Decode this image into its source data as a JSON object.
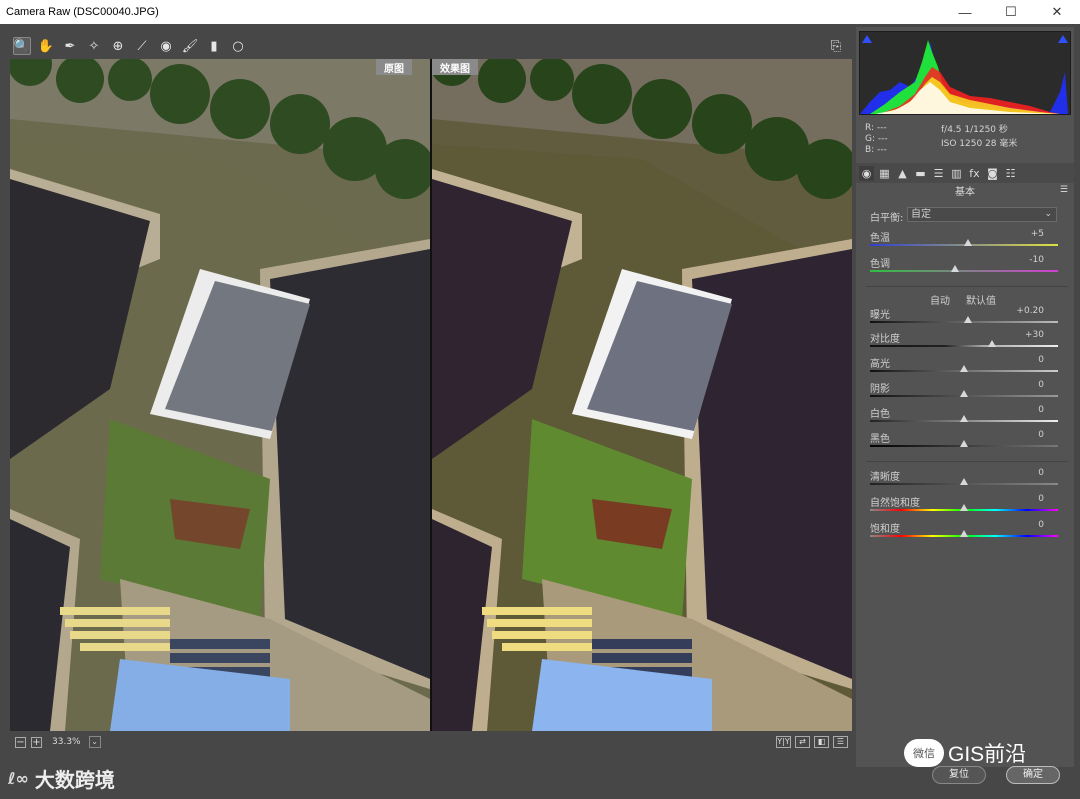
{
  "window": {
    "title": "Camera Raw (DSC00040.JPG)",
    "minimize": "—",
    "maximize": "☐",
    "close": "✕"
  },
  "toolbar": {
    "tools": [
      {
        "name": "zoom-tool-icon",
        "glyph": "🔍"
      },
      {
        "name": "hand-tool-icon",
        "glyph": "✋"
      },
      {
        "name": "white-balance-tool-icon",
        "glyph": "✒"
      },
      {
        "name": "color-sampler-tool-icon",
        "glyph": "✧"
      },
      {
        "name": "targeted-adjustment-tool-icon",
        "glyph": "⊕"
      },
      {
        "name": "straighten-tool-icon",
        "glyph": "⟋"
      },
      {
        "name": "red-eye-tool-icon",
        "glyph": "◉"
      },
      {
        "name": "adjustment-brush-icon",
        "glyph": "🖌"
      },
      {
        "name": "graduated-filter-icon",
        "glyph": "▮"
      },
      {
        "name": "radial-filter-icon",
        "glyph": "○"
      }
    ],
    "export_glyph": "⎘"
  },
  "preview": {
    "before_label": "原图",
    "after_label": "效果图"
  },
  "bottom_bar": {
    "zoom_out": "−",
    "zoom_in": "+",
    "zoom_value": "33.3%",
    "zoom_dropdown": "⌄",
    "view_buttons": [
      "Y|Y",
      "⇄",
      "◧",
      "☰"
    ]
  },
  "histogram": {
    "colors": {
      "red": "#ff2020",
      "green": "#20ff20",
      "blue": "#2030ff",
      "yellow": "#ffff20",
      "white": "#ffffff"
    }
  },
  "metadata": {
    "r": "R: ---",
    "g": "G: ---",
    "b": "B: ---",
    "exif_line1": "f/4.5  1/1250 秒",
    "exif_line2": "ISO 1250  28 毫米"
  },
  "panel_tabs": [
    "◉",
    "▦",
    "▲",
    "▬",
    "☰",
    "▥",
    "fx",
    "◙",
    "☷"
  ],
  "basic": {
    "section_title": "基本",
    "section_menu": "☰",
    "white_balance_label": "白平衡:",
    "white_balance_value": "自定",
    "white_balance_dropdown": "⌄",
    "auto": "自动",
    "defaults": "默认值",
    "sliders": [
      {
        "label": "色温",
        "value": "+5",
        "position": 0.52
      },
      {
        "label": "色调",
        "value": "-10",
        "position": 0.45
      },
      {
        "label": "曝光",
        "value": "+0.20",
        "position": 0.52
      },
      {
        "label": "对比度",
        "value": "+30",
        "position": 0.65
      },
      {
        "label": "高光",
        "value": "0",
        "position": 0.5
      },
      {
        "label": "阴影",
        "value": "0",
        "position": 0.5
      },
      {
        "label": "白色",
        "value": "0",
        "position": 0.5
      },
      {
        "label": "黑色",
        "value": "0",
        "position": 0.5
      },
      {
        "label": "清晰度",
        "value": "0",
        "position": 0.5
      },
      {
        "label": "自然饱和度",
        "value": "0",
        "position": 0.5
      },
      {
        "label": "饱和度",
        "value": "0",
        "position": 0.5
      }
    ]
  },
  "buttons": {
    "reset": "复位",
    "ok": "确定"
  },
  "watermark": {
    "icon": "微信",
    "text": "GIS前沿"
  },
  "logo": {
    "icon": "ℓ∞",
    "text": "大数跨境"
  }
}
